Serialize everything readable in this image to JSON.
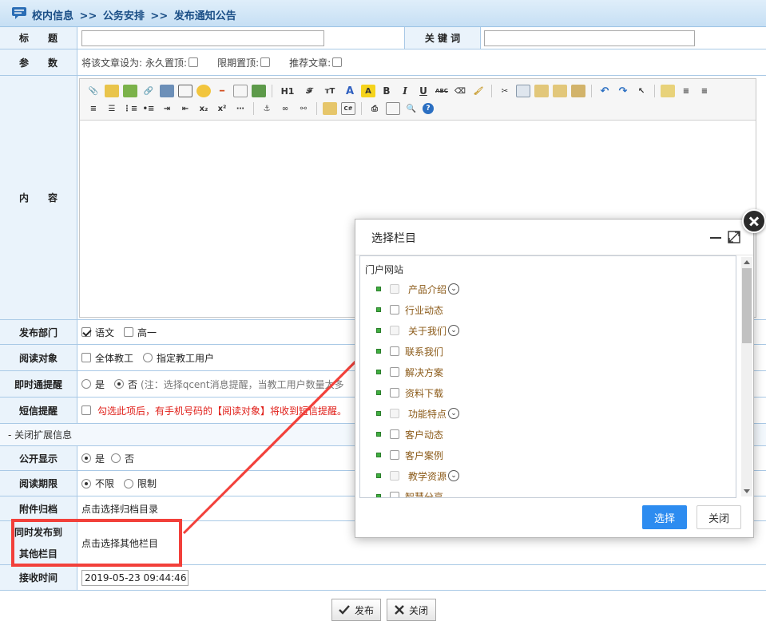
{
  "breadcrumb": {
    "items": [
      "校内信息",
      "公务安排",
      "发布通知公告"
    ],
    "separator": ">>"
  },
  "form": {
    "title_label": "标　　题",
    "keyword_label": "关 键 词",
    "param_label": "参　　数",
    "param_prefix": "将该文章设为:",
    "param_permanent": "永久置顶:",
    "param_limited": "限期置顶:",
    "param_recommend": "推荐文章:",
    "content_label": "内　　容",
    "dept_label": "发布部门",
    "dept_options": [
      {
        "label": "语文",
        "checked": true
      },
      {
        "label": "高一",
        "checked": false
      }
    ],
    "audience_label": "阅读对象",
    "audience_options": [
      {
        "label": "全体教工",
        "type": "checkbox"
      },
      {
        "label": "指定教工用户",
        "type": "radio"
      }
    ],
    "remind_label": "即时通提醒",
    "remind_yes": "是",
    "remind_no": "否",
    "remind_note": "(注：选择qcent消息提醒，当教工用户数量太多",
    "sms_label": "短信提醒",
    "sms_note": "勾选此项后，有手机号码的【阅读对象】将收到短信提醒。",
    "collapse_label": "- 关闭扩展信息",
    "public_label": "公开显示",
    "public_yes": "是",
    "public_no": "否",
    "period_label": "阅读期限",
    "period_unlimited": "不限",
    "period_limited": "限制",
    "archive_label": "附件归档",
    "archive_value": "点击选择归档目录",
    "copublish_label_1": "同时发布到",
    "copublish_label_2": "其他栏目",
    "copublish_value": "点击选择其他栏目",
    "receive_label": "接收时间",
    "receive_value": "2019-05-23 09:44:46"
  },
  "editor_toolbar": {
    "font_labels": [
      "H1",
      "𝓕",
      "тT",
      "A",
      "A",
      "B",
      "I",
      "U",
      "ABC"
    ]
  },
  "buttons": {
    "publish": "发布",
    "close": "关闭"
  },
  "modal": {
    "title": "选择栏目",
    "root": "门户网站",
    "items": [
      {
        "label": "产品介绍",
        "expandable": true
      },
      {
        "label": "行业动态",
        "expandable": false
      },
      {
        "label": "关于我们",
        "expandable": true
      },
      {
        "label": "联系我们",
        "expandable": false
      },
      {
        "label": "解决方案",
        "expandable": false
      },
      {
        "label": "资料下载",
        "expandable": false
      },
      {
        "label": "功能特点",
        "expandable": true
      },
      {
        "label": "客户动态",
        "expandable": false
      },
      {
        "label": "客户案例",
        "expandable": false
      },
      {
        "label": "教学资源",
        "expandable": true
      },
      {
        "label": "智慧分享",
        "expandable": false
      }
    ],
    "select_label": "选择",
    "close_label": "关闭"
  },
  "colors": {
    "primary": "#2d8cf0",
    "highlight": "#f2403a",
    "header": "#c6dff4",
    "label_bg": "#eaf3fb"
  }
}
